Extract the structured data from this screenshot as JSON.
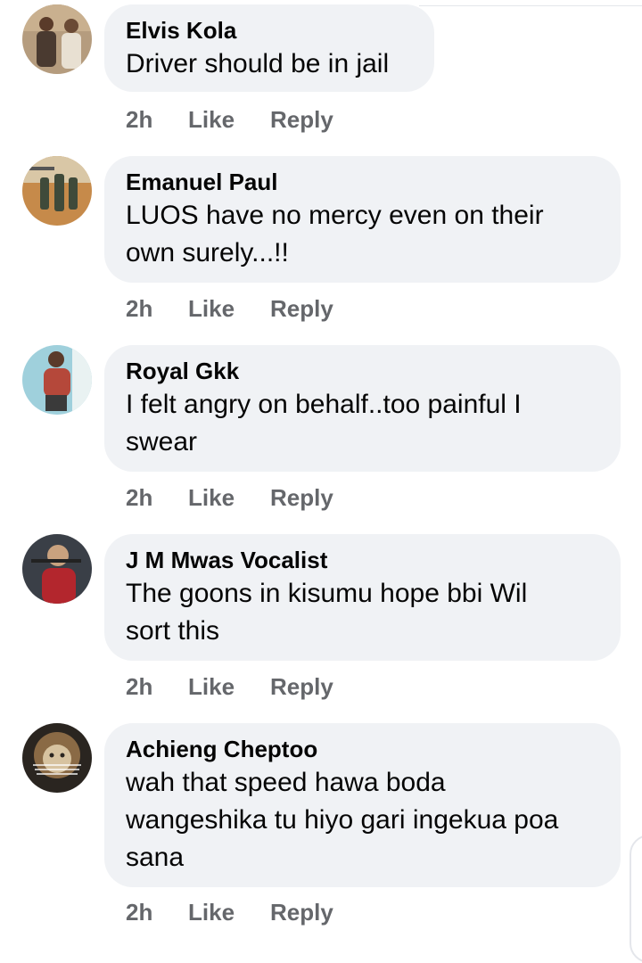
{
  "comments": [
    {
      "author": "Elvis Kola",
      "lines": [
        "Driver should be in jail"
      ],
      "time": "2h",
      "like_label": "Like",
      "reply_label": "Reply",
      "avatar_palette": {
        "bg": "#b59c7e",
        "accent": "#5a3b2a",
        "light": "#e8e0d2"
      }
    },
    {
      "author": "Emanuel Paul",
      "lines": [
        "LUOS have no mercy even on their",
        "own surely...!!"
      ],
      "time": "2h",
      "like_label": "Like",
      "reply_label": "Reply",
      "avatar_palette": {
        "bg": "#c68a4a",
        "accent": "#3f4a3a",
        "light": "#d9c7a6"
      }
    },
    {
      "author": "Royal Gkk",
      "lines": [
        "I felt angry on behalf..too painful I",
        "swear"
      ],
      "time": "2h",
      "like_label": "Like",
      "reply_label": "Reply",
      "avatar_palette": {
        "bg": "#9fd0dc",
        "accent": "#b5483a",
        "light": "#e9f2f2"
      }
    },
    {
      "author": "J M Mwas Vocalist",
      "lines": [
        "The goons in kisumu hope bbi Wil",
        "sort this"
      ],
      "time": "2h",
      "like_label": "Like",
      "reply_label": "Reply",
      "avatar_palette": {
        "bg": "#3a3f47",
        "accent": "#b3262d",
        "light": "#c9a27f"
      }
    },
    {
      "author": "Achieng Cheptoo",
      "lines": [
        "wah that speed hawa boda",
        "wangeshika tu hiyo gari ingekua poa",
        "sana"
      ],
      "time": "2h",
      "like_label": "Like",
      "reply_label": "Reply",
      "avatar_palette": {
        "bg": "#2a2520",
        "accent": "#8a6a45",
        "light": "#d7c3a0"
      }
    }
  ]
}
